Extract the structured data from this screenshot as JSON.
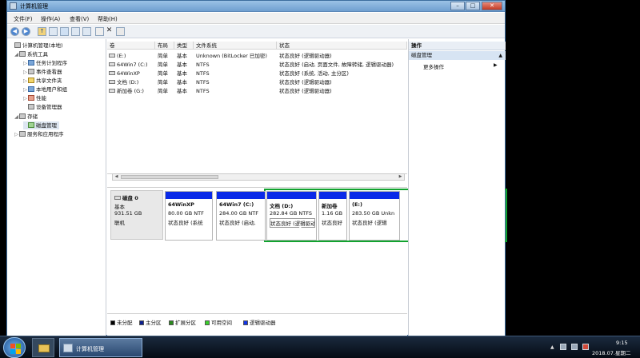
{
  "window": {
    "title": "计算机管理",
    "min": "–",
    "max": "□",
    "close": "✕"
  },
  "menu": [
    "文件(F)",
    "操作(A)",
    "查看(V)",
    "帮助(H)"
  ],
  "toolbar": {
    "back": "◀",
    "forward": "▶",
    "up": "↑",
    "delete": "✕"
  },
  "tree": [
    {
      "label": "计算机管理(本地)",
      "level": 0,
      "icon": "computer-icon",
      "expand": ""
    },
    {
      "label": "系统工具",
      "level": 1,
      "icon": "tools-icon",
      "expand": "◢"
    },
    {
      "label": "任务计划程序",
      "level": 2,
      "icon": "task-scheduler-icon",
      "expand": "▷"
    },
    {
      "label": "事件查看器",
      "level": 2,
      "icon": "event-viewer-icon",
      "expand": "▷"
    },
    {
      "label": "共享文件夹",
      "level": 2,
      "icon": "shared-folder-icon",
      "expand": "▷"
    },
    {
      "label": "本地用户和组",
      "level": 2,
      "icon": "users-icon",
      "expand": "▷"
    },
    {
      "label": "性能",
      "level": 2,
      "icon": "performance-icon",
      "expand": "▷"
    },
    {
      "label": "设备管理器",
      "level": 2,
      "icon": "device-manager-icon",
      "expand": ""
    },
    {
      "label": "存储",
      "level": 1,
      "icon": "storage-icon",
      "expand": "◢"
    },
    {
      "label": "磁盘管理",
      "level": 2,
      "icon": "disk-management-icon",
      "expand": ""
    },
    {
      "label": "服务和应用程序",
      "level": 1,
      "icon": "services-icon",
      "expand": "▷"
    }
  ],
  "table": {
    "columns": [
      "卷",
      "布局",
      "类型",
      "文件系统",
      "状态"
    ],
    "rows": [
      [
        "(E:)",
        "简单",
        "基本",
        "Unknown (BitLocker 已加密)",
        "状态良好 (逻辑驱动器)"
      ],
      [
        "64Win7 (C:)",
        "简单",
        "基本",
        "NTFS",
        "状态良好 (启动, 页面文件, 故障转储, 逻辑驱动器)"
      ],
      [
        "64WinXP",
        "简单",
        "基本",
        "NTFS",
        "状态良好 (系统, 活动, 主分区)"
      ],
      [
        "文档 (D:)",
        "简单",
        "基本",
        "NTFS",
        "状态良好 (逻辑驱动器)"
      ],
      [
        "新加卷 (G:)",
        "简单",
        "基本",
        "NTFS",
        "状态良好 (逻辑驱动器)"
      ]
    ]
  },
  "disk": {
    "name": "磁盘 0",
    "type": "基本",
    "size": "931.51 GB",
    "status": "联机"
  },
  "partitions": [
    {
      "name": "64WinXP",
      "size": "80.00 GB NTF",
      "status": "状态良好 (系统",
      "bar": "#0a2ae8"
    },
    {
      "name": "64Win7  (C:)",
      "size": "284.00 GB NTF",
      "status": "状态良好 (启动,",
      "bar": "#0a2ae8"
    },
    {
      "name": "文档  (D:)",
      "size": "282.84 GB NTFS",
      "status": "状态良好 (逻辑驱动器)",
      "bar": "#0a2ae8"
    },
    {
      "name": "新加卷",
      "size": "1.16 GB",
      "status": "状态良好",
      "bar": "#0a2ae8"
    },
    {
      "name": "(E:)",
      "size": "283.50 GB Unkn",
      "status": "状态良好 (逻辑",
      "bar": "#0a2ae8"
    }
  ],
  "legend": [
    {
      "label": "未分配",
      "color": "#000000"
    },
    {
      "label": "主分区",
      "color": "#0b1f8f"
    },
    {
      "label": "扩展分区",
      "color": "#2b8a1e"
    },
    {
      "label": "可用空间",
      "color": "#39d12b"
    },
    {
      "label": "逻辑驱动器",
      "color": "#1235e8"
    }
  ],
  "actions": {
    "header": "操作",
    "section": "磁盘管理",
    "more": "更多操作",
    "section_arrow": "▲",
    "more_arrow": "▶"
  },
  "taskbar": {
    "app_label": "计算机管理",
    "time": "9:15",
    "date": "2018.07.星期二",
    "tray_arrow": "▲"
  }
}
